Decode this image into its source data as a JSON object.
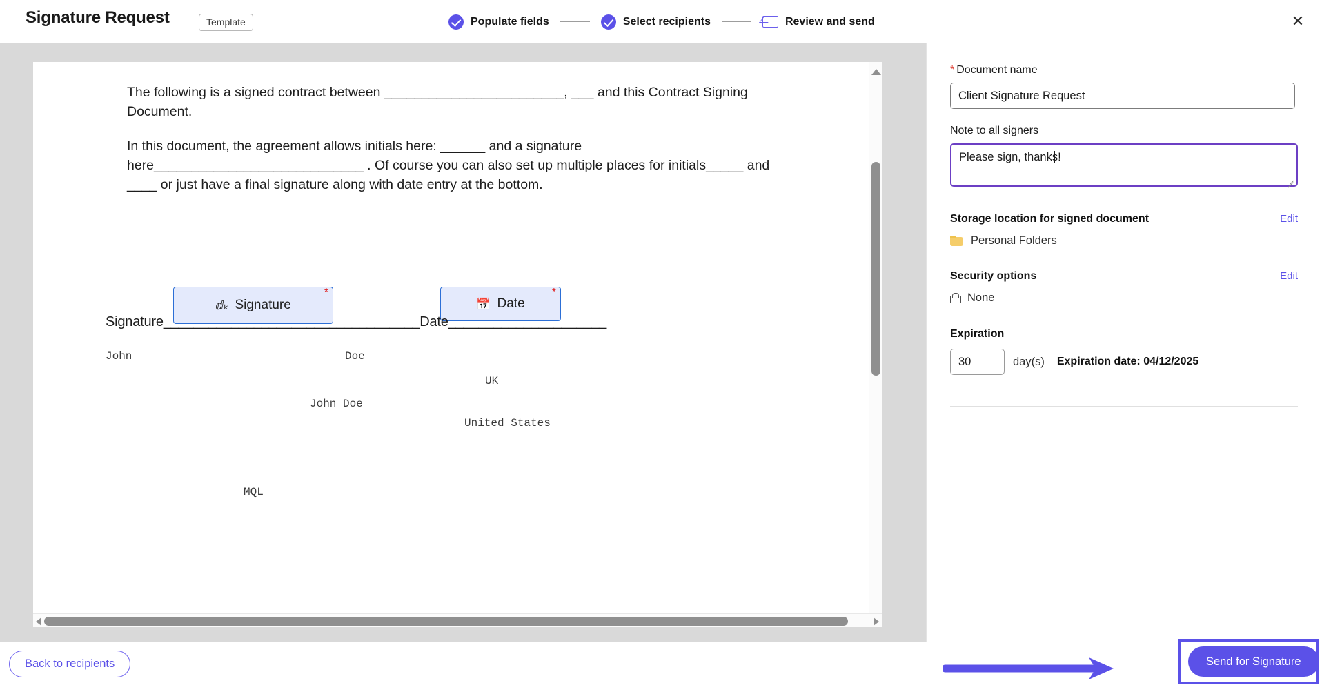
{
  "header": {
    "title": "Signature Request",
    "badge": "Template",
    "close_icon": "close-icon",
    "steps": [
      {
        "label": "Populate fields",
        "icon": "check-circle-icon",
        "state": "complete"
      },
      {
        "label": "Select recipients",
        "icon": "check-circle-icon",
        "state": "complete"
      },
      {
        "label": "Review and send",
        "icon": "mail-icon",
        "state": "current"
      }
    ]
  },
  "document": {
    "paragraph_1": "The following is a signed contract between ________________________, ___ and this Contract Signing Document.",
    "paragraph_2": "In this document, the agreement allows initials here: ______ and a signature here____________________________ . Of course you can also set up multiple places for initials_____ and ____ or just have a final signature along with date entry at the bottom.",
    "signature_line": "Signature__________________________________Date_____________________",
    "fields": [
      {
        "label": "Signature",
        "icon": "signature-icon",
        "required": "*"
      },
      {
        "label": "Date",
        "icon": "calendar-icon",
        "required": "*"
      }
    ],
    "merge_values": [
      {
        "text": "John"
      },
      {
        "text": "Doe"
      },
      {
        "text": "UK"
      },
      {
        "text": "John Doe"
      },
      {
        "text": "United States"
      },
      {
        "text": "MQL"
      }
    ],
    "scrollbar": {
      "up_icon": "scroll-up-arrow-icon",
      "down_icon": "scroll-down-arrow-icon",
      "left_icon": "scroll-left-arrow-icon",
      "right_icon": "scroll-right-arrow-icon"
    }
  },
  "panel": {
    "document_name": {
      "label": "Document name",
      "required_marker": "*",
      "value": "Client Signature Request"
    },
    "note": {
      "label": "Note to all signers",
      "value": "Please sign, thanks!"
    },
    "storage": {
      "title": "Storage location for signed document",
      "edit_label": "Edit",
      "value": "Personal Folders",
      "icon": "folder-icon"
    },
    "security": {
      "title": "Security options",
      "edit_label": "Edit",
      "value": "None",
      "icon": "lock-icon"
    },
    "expiration": {
      "title": "Expiration",
      "days": "30",
      "unit": "day(s)",
      "date_text": "Expiration date: 04/12/2025"
    }
  },
  "footer": {
    "back_label": "Back to recipients",
    "send_label": "Send for Signature",
    "annotation_icon": "arrow-right-annotation"
  },
  "colors": {
    "accent": "#5b51e8",
    "focus_border": "#6c3fc4",
    "field_fill": "#e4eafc",
    "field_border": "#2c6fd6",
    "required": "#e0453a",
    "viewer_bg": "#d9d9d9"
  }
}
